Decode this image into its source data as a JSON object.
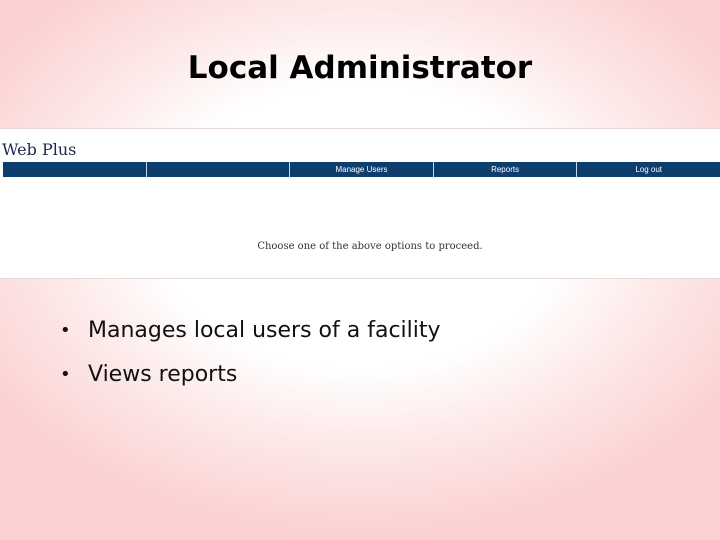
{
  "slide": {
    "title": "Local Administrator",
    "bullets": [
      "Manages local users of a facility",
      "Views reports"
    ]
  },
  "app": {
    "logo": "Web Plus",
    "nav": [
      "",
      "",
      "Manage Users",
      "Reports",
      "Log out"
    ],
    "message": "Choose one of the above options to proceed."
  },
  "colors": {
    "nav_bar": "#0e3e6e",
    "slide_edge": "#fbd0d0"
  }
}
